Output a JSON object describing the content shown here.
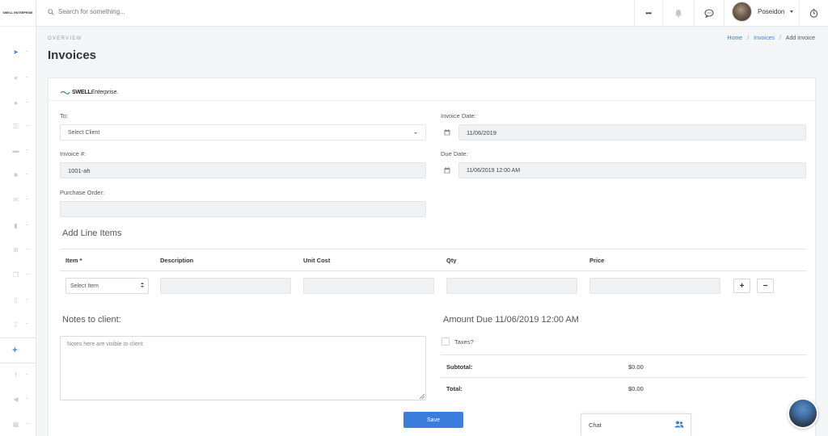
{
  "sidebar": {
    "logo": "SWELL ENTERPRISE",
    "items": [
      {
        "icon": "paper-plane-icon",
        "glyph": "➤",
        "active": true
      },
      {
        "icon": "user-icon",
        "glyph": "●"
      },
      {
        "icon": "users-icon",
        "glyph": "●"
      },
      {
        "icon": "list-icon",
        "glyph": "☰"
      },
      {
        "icon": "folder-icon",
        "glyph": "▬"
      },
      {
        "icon": "check-square-icon",
        "glyph": "■"
      },
      {
        "icon": "envelope-icon",
        "glyph": "✉"
      },
      {
        "icon": "clipboard-icon",
        "glyph": "▮"
      },
      {
        "icon": "sitemap-icon",
        "glyph": "⊞"
      },
      {
        "icon": "copy-icon",
        "glyph": "❐"
      },
      {
        "icon": "file-icon",
        "glyph": "▯"
      },
      {
        "icon": "file-alt-icon",
        "glyph": "▯"
      }
    ],
    "plus_glyph": "+",
    "bottom": [
      {
        "icon": "facebook-icon",
        "glyph": "f"
      },
      {
        "icon": "bullhorn-icon",
        "glyph": "◀"
      },
      {
        "icon": "table-icon",
        "glyph": "▦"
      }
    ]
  },
  "header": {
    "search_placeholder": "Search for something...",
    "more_glyph": "•••",
    "user_name": "Poseidon"
  },
  "page": {
    "overview": "OVERVIEW",
    "title": "Invoices",
    "breadcrumbs": [
      "Home",
      "Invoices",
      "Add invoice"
    ],
    "crumb_sep": "/"
  },
  "invoice": {
    "brand_bold": "SWELL",
    "brand_italic": "Enterprise.",
    "to_label": "To:",
    "client_placeholder": "Select Client",
    "invoice_date_label": "Invoice Date:",
    "invoice_date": "11/06/2019",
    "number_label": "Invoice #:",
    "number_value": "1001-ah",
    "due_date_label": "Due Date:",
    "due_date": "11/06/2019 12:00 AM",
    "po_label": "Purchase Order:",
    "po_value": ""
  },
  "line_items": {
    "title": "Add Line Items",
    "columns": [
      "Item *",
      "Description",
      "Unit Cost",
      "Qty",
      "Price"
    ],
    "item_placeholder": "Select Item",
    "add_glyph": "+",
    "remove_glyph": "−"
  },
  "notes": {
    "title": "Notes to client:",
    "placeholder": "Notes here are visible to client"
  },
  "amount": {
    "title": "Amount Due 11/06/2019 12:00 AM",
    "taxes_label": "Taxes?",
    "subtotal_label": "Subtotal:",
    "subtotal_value": "$0.00",
    "total_label": "Total:",
    "total_value": "$0.00"
  },
  "save_label": "Save",
  "chat": {
    "label": "Chat"
  },
  "colors": {
    "accent": "#3b7ddd",
    "field_bg": "#f0f1f3"
  }
}
